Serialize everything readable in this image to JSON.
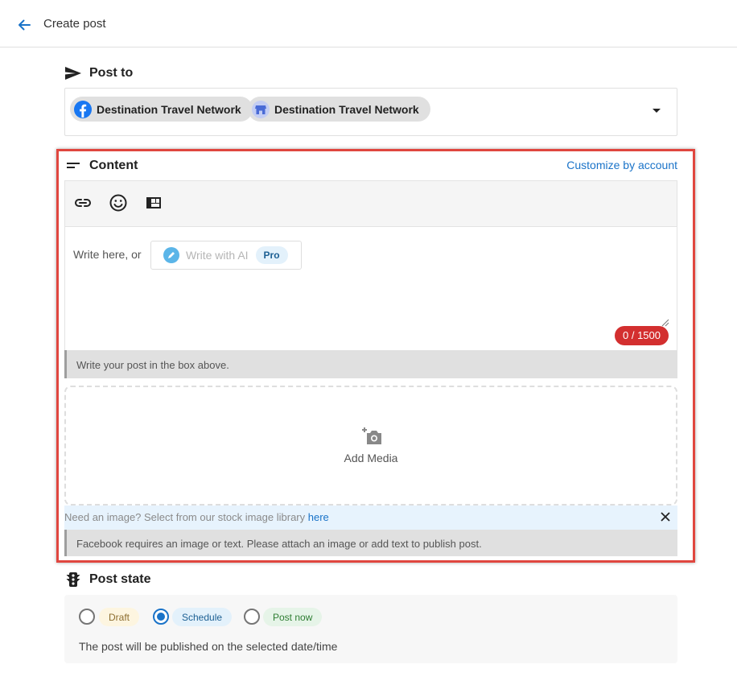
{
  "header": {
    "title": "Create post",
    "back_icon": "arrow-left-icon"
  },
  "post_to": {
    "heading": "Post to",
    "icon": "send-icon",
    "accounts": [
      {
        "name": "Destination Travel Network",
        "network": "facebook",
        "icon": "facebook-icon"
      },
      {
        "name": "Destination Travel Network",
        "network": "google-business",
        "icon": "store-icon"
      }
    ]
  },
  "content": {
    "heading": "Content",
    "icon": "short-text-icon",
    "customize_label": "Customize by account",
    "toolbar": [
      "link-icon",
      "emoji-icon",
      "layout-icon"
    ],
    "editor_prompt": "Write here, or",
    "ai_button_label": "Write with AI",
    "pro_badge": "Pro",
    "char_counter": "0 / 1500",
    "hint": "Write your post in the box above.",
    "media_label": "Add Media",
    "stock_text": "Need an image? Select from our stock image library ",
    "stock_link": "here",
    "warning": "Facebook requires an image or text. Please attach an image or add text to publish post."
  },
  "post_state": {
    "heading": "Post state",
    "icon": "traffic-light-icon",
    "options": [
      {
        "label": "Draft",
        "selected": false,
        "bg": "#fdf5e0",
        "fg": "#8d6e2f"
      },
      {
        "label": "Schedule",
        "selected": true,
        "bg": "#e3f1fb",
        "fg": "#1c5f93"
      },
      {
        "label": "Post now",
        "selected": false,
        "bg": "#e6f4e8",
        "fg": "#2e7d32"
      }
    ],
    "description": "The post will be published on the selected date/time"
  },
  "colors": {
    "accent": "#1a73c8",
    "highlight_border": "#e0463f",
    "counter_bg": "#d32f2f"
  }
}
